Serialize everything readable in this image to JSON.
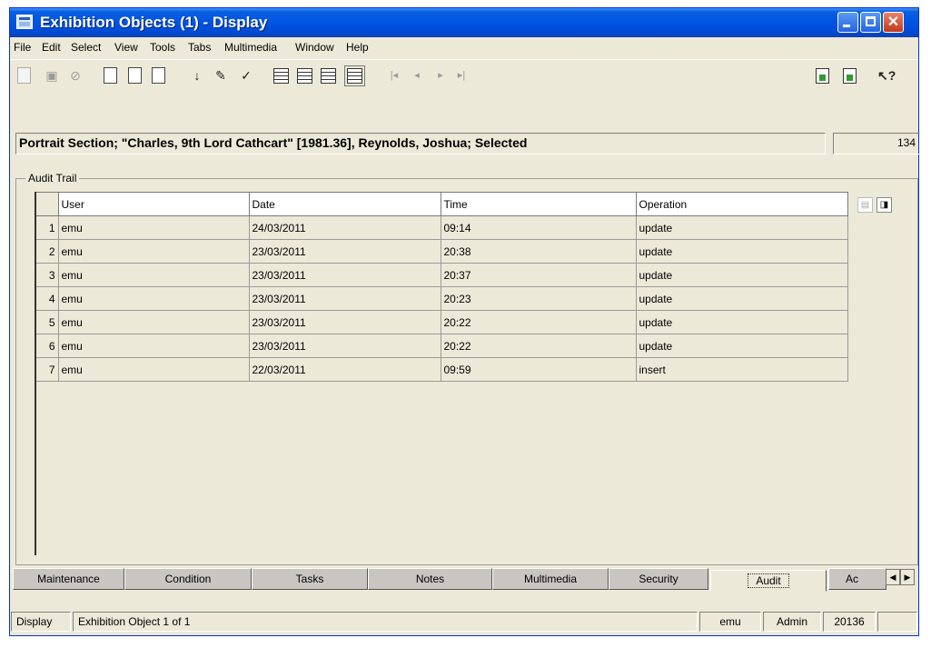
{
  "window": {
    "title": "Exhibition Objects (1) - Display"
  },
  "menu": [
    "File",
    "Edit",
    "Select",
    "View",
    "Tools",
    "Tabs",
    "Multimedia",
    "Window",
    "Help"
  ],
  "toolbar": {
    "icons": [
      "new-icon",
      "save-icon",
      "cancel-icon",
      "search-icon",
      "search-add-icon",
      "list-icon",
      "sort-icon",
      "edit-icon",
      "spellcheck-icon",
      "page-view-icon",
      "list-view-icon",
      "contact-sheet-icon",
      "details-view-icon",
      "first-icon",
      "previous-icon",
      "next-icon",
      "last-icon",
      "import-icon",
      "export-icon",
      "help-icon"
    ]
  },
  "summary": {
    "text": "Portrait Section; \"Charles, 9th Lord Cathcart\" [1981.36], Reynolds, Joshua; Selected",
    "count": "134"
  },
  "audit": {
    "group_label": "Audit Trail",
    "columns": [
      "User",
      "Date",
      "Time",
      "Operation"
    ],
    "rows": [
      {
        "num": "1",
        "user": "emu",
        "date": "24/03/2011",
        "time": "09:14",
        "operation": "update"
      },
      {
        "num": "2",
        "user": "emu",
        "date": "23/03/2011",
        "time": "20:38",
        "operation": "update"
      },
      {
        "num": "3",
        "user": "emu",
        "date": "23/03/2011",
        "time": "20:37",
        "operation": "update"
      },
      {
        "num": "4",
        "user": "emu",
        "date": "23/03/2011",
        "time": "20:23",
        "operation": "update"
      },
      {
        "num": "5",
        "user": "emu",
        "date": "23/03/2011",
        "time": "20:22",
        "operation": "update"
      },
      {
        "num": "6",
        "user": "emu",
        "date": "23/03/2011",
        "time": "20:22",
        "operation": "update"
      },
      {
        "num": "7",
        "user": "emu",
        "date": "22/03/2011",
        "time": "09:59",
        "operation": "insert"
      }
    ]
  },
  "tabs": [
    "Maintenance",
    "Condition",
    "Tasks",
    "Notes",
    "Multimedia",
    "Security",
    "Audit",
    "Ac"
  ],
  "active_tab": "Audit",
  "status": {
    "mode": "Display",
    "record": "Exhibition Object 1 of 1",
    "user": "emu",
    "group": "Admin",
    "id": "20136"
  }
}
